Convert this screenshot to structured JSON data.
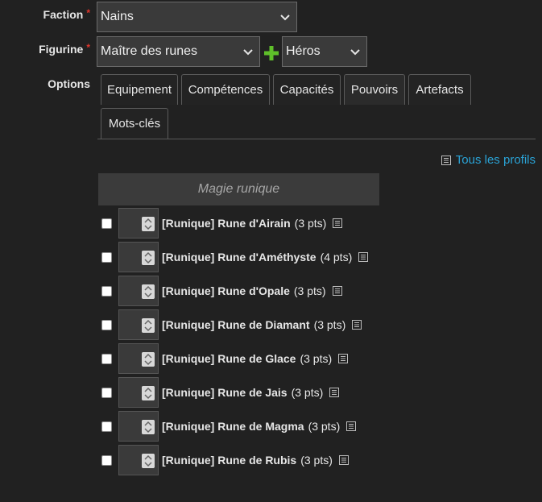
{
  "form": {
    "faction_label": "Faction",
    "faction_required": "*",
    "faction_value": "Nains",
    "figurine_label": "Figurine",
    "figurine_required": "*",
    "figurine_value": "Maître des runes",
    "figurine_type_value": "Héros",
    "options_label": "Options"
  },
  "tabs": [
    {
      "label": "Equipement",
      "active": false
    },
    {
      "label": "Compétences",
      "active": false
    },
    {
      "label": "Capacités",
      "active": false
    },
    {
      "label": "Pouvoirs",
      "active": true
    },
    {
      "label": "Artefacts",
      "active": false
    },
    {
      "label": "Mots-clés",
      "active": false
    }
  ],
  "profiles_link": "Tous les profils",
  "group": {
    "title": "Magie runique",
    "items": [
      {
        "name": "[Runique] Rune d'Airain",
        "pts": "(3 pts)"
      },
      {
        "name": "[Runique] Rune d'Améthyste",
        "pts": "(4 pts)"
      },
      {
        "name": "[Runique] Rune d'Opale",
        "pts": "(3 pts)"
      },
      {
        "name": "[Runique] Rune de Diamant",
        "pts": "(3 pts)"
      },
      {
        "name": "[Runique] Rune de Glace",
        "pts": "(3 pts)"
      },
      {
        "name": "[Runique] Rune de Jais",
        "pts": "(3 pts)"
      },
      {
        "name": "[Runique] Rune de Magma",
        "pts": "(3 pts)"
      },
      {
        "name": "[Runique] Rune de Rubis",
        "pts": "(3 pts)"
      }
    ]
  },
  "colors": {
    "background": "#212121",
    "link": "#2aa3d6",
    "required": "#e0352b",
    "plus": "#5fbf2a"
  }
}
